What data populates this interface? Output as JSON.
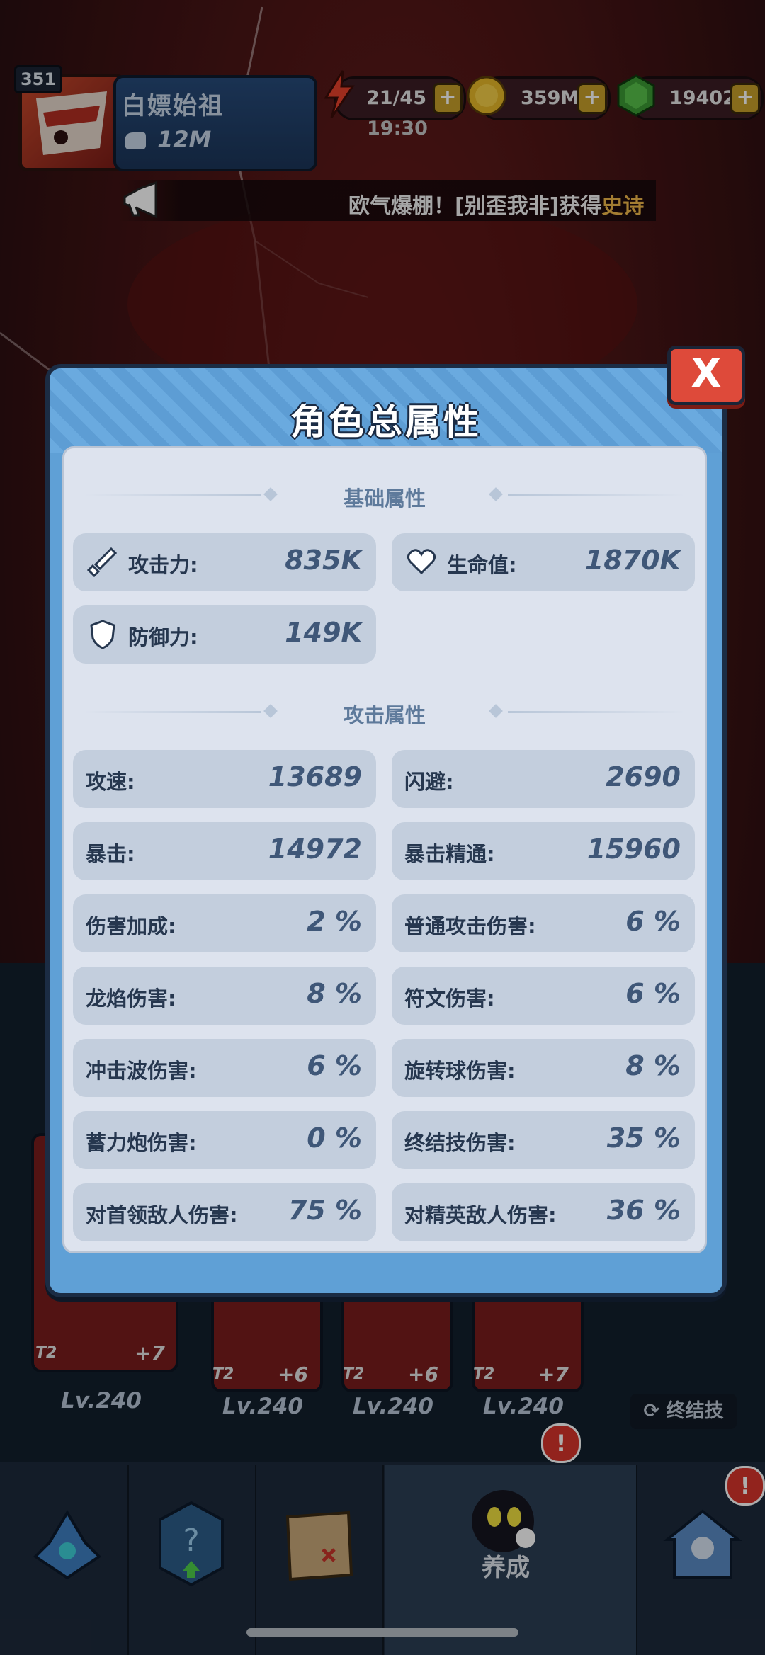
{
  "hud": {
    "level": "351",
    "player_name": "白嫖始祖",
    "power": "12M",
    "energy": "21/45",
    "gold": "359M",
    "gems": "19402",
    "timer": "19:30",
    "plus": "+"
  },
  "ticker": {
    "text_main": "欧气爆棚！[别歪我非]获得",
    "text_highlight": "史诗"
  },
  "modal": {
    "title": "角色总属性",
    "close_label": "X",
    "basic_section": "基础属性",
    "attack_section": "攻击属性",
    "basic_stats": [
      {
        "label": "攻击力:",
        "value": "835K",
        "icon": "sword-icon"
      },
      {
        "label": "生命值:",
        "value": "1870K",
        "icon": "heart-icon"
      },
      {
        "label": "防御力:",
        "value": "149K",
        "icon": "shield-icon"
      }
    ],
    "attack_stats": [
      {
        "label": "攻速:",
        "value": "13689"
      },
      {
        "label": "闪避:",
        "value": "2690"
      },
      {
        "label": "暴击:",
        "value": "14972"
      },
      {
        "label": "暴击精通:",
        "value": "15960"
      },
      {
        "label": "伤害加成:",
        "value": "2 %"
      },
      {
        "label": "普通攻击伤害:",
        "value": "6 %"
      },
      {
        "label": "龙焰伤害:",
        "value": "8 %"
      },
      {
        "label": "符文伤害:",
        "value": "6 %"
      },
      {
        "label": "冲击波伤害:",
        "value": "6 %"
      },
      {
        "label": "旋转球伤害:",
        "value": "8 %"
      },
      {
        "label": "蓄力炮伤害:",
        "value": "0 %"
      },
      {
        "label": "终结技伤害:",
        "value": "35 %"
      },
      {
        "label": "对首领敌人伤害:",
        "value": "75 %"
      },
      {
        "label": "对精英敌人伤害:",
        "value": "36 %"
      }
    ]
  },
  "equipment": [
    {
      "level": "Lv.240",
      "tier": "T2",
      "bonus": "+7"
    },
    {
      "level": "Lv.240",
      "tier": "T2",
      "bonus": "+6"
    },
    {
      "level": "Lv.240",
      "tier": "T2",
      "bonus": "+6"
    },
    {
      "level": "Lv.240",
      "tier": "T2",
      "bonus": "+7"
    }
  ],
  "finisher_button": "终结技",
  "nav": {
    "active_label": "养成",
    "alert": "!"
  },
  "colors": {
    "modal_blue": "#5fa0d6",
    "close_red": "#de4a3a",
    "stat_value": "#3f5778",
    "highlight_gold": "#f0b84a"
  }
}
